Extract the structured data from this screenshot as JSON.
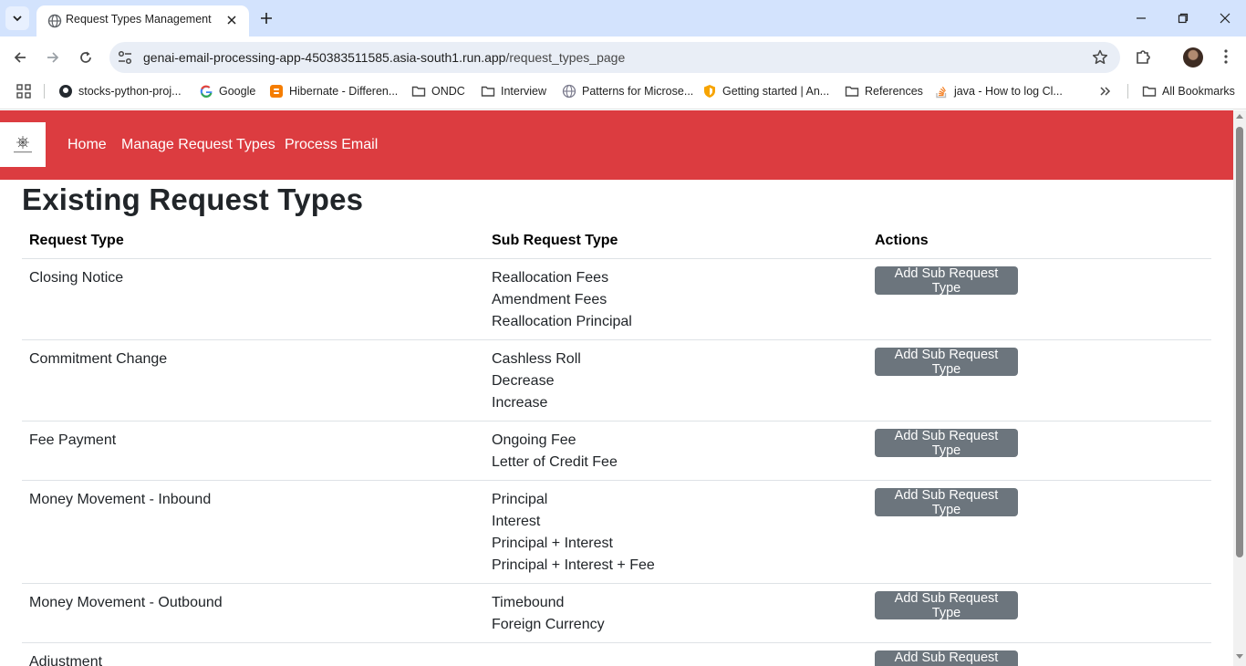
{
  "browser": {
    "tab_title": "Request Types Management",
    "url_host": "genai-email-processing-app-450383511585.asia-south1.run.app",
    "url_path": "/request_types_page"
  },
  "bookmarks": [
    {
      "label": "stocks-python-proj...",
      "icon": "github-icon"
    },
    {
      "label": "Google",
      "icon": "google-icon"
    },
    {
      "label": "Hibernate - Differen...",
      "icon": "blogger-icon"
    },
    {
      "label": "ONDC",
      "icon": "folder-icon"
    },
    {
      "label": "Interview",
      "icon": "folder-icon"
    },
    {
      "label": "Patterns for Microse...",
      "icon": "globe-icon"
    },
    {
      "label": "Getting started | An...",
      "icon": "shield-icon"
    },
    {
      "label": "References",
      "icon": "folder-icon"
    },
    {
      "label": "java - How to log Cl...",
      "icon": "stackoverflow-icon"
    }
  ],
  "all_bookmarks_label": "All Bookmarks",
  "navbar": {
    "color": "#dc3c40",
    "links": [
      "Home",
      "Manage Request Types",
      "Process Email"
    ]
  },
  "page": {
    "title": "Existing Request Types",
    "headers": {
      "request_type": "Request Type",
      "sub_request_type": "Sub Request Type",
      "actions": "Actions"
    },
    "button_label": "Add Sub Request Type",
    "rows": [
      {
        "type": "Closing Notice",
        "subs": [
          "Reallocation Fees",
          "Amendment Fees",
          "Reallocation Principal"
        ]
      },
      {
        "type": "Commitment Change",
        "subs": [
          "Cashless Roll",
          "Decrease",
          "Increase"
        ]
      },
      {
        "type": "Fee Payment",
        "subs": [
          "Ongoing Fee",
          "Letter of Credit Fee"
        ]
      },
      {
        "type": "Money Movement - Inbound",
        "subs": [
          "Principal",
          "Interest",
          "Principal + Interest",
          "Principal + Interest + Fee"
        ]
      },
      {
        "type": "Money Movement - Outbound",
        "subs": [
          "Timebound",
          "Foreign Currency"
        ]
      },
      {
        "type": "Adjustment",
        "subs": []
      }
    ]
  }
}
